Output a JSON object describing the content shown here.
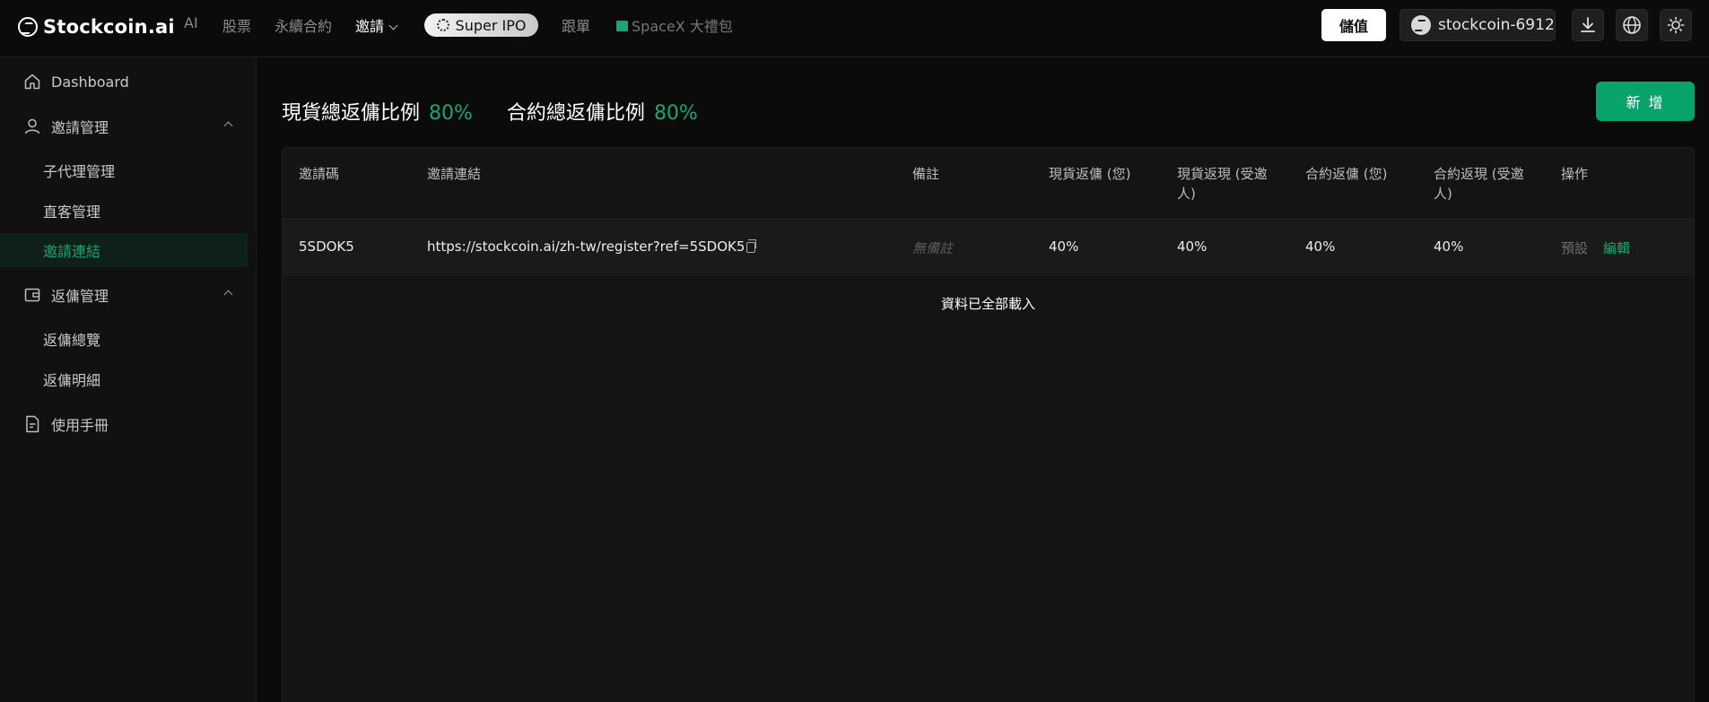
{
  "app": {
    "brand": "Stockcoin.ai"
  },
  "header": {
    "nav": {
      "ai": "AI",
      "stocks": "股票",
      "perpetual": "永續合約",
      "invite": "邀請",
      "super_ipo": "Super IPO",
      "copy_trade": "跟單",
      "spacex": "SpaceX 大禮包"
    },
    "deposit_label": "儲值",
    "username": "stockcoin-6912",
    "icons": [
      "download-icon",
      "globe-icon",
      "sun-icon"
    ]
  },
  "sidebar": {
    "dashboard": "Dashboard",
    "invite_group": {
      "label": "邀請管理",
      "items": [
        "子代理管理",
        "直客管理",
        "邀請連結"
      ],
      "active_index": 2
    },
    "rebate_group": {
      "label": "返傭管理",
      "items": [
        "返傭總覽",
        "返傭明細"
      ]
    },
    "manual": "使用手冊"
  },
  "main": {
    "spot_ratio_label": "現貨總返傭比例",
    "spot_ratio_value": "80%",
    "contract_ratio_label": "合約總返傭比例",
    "contract_ratio_value": "80%",
    "add_button": "新 增",
    "table": {
      "headers": [
        "邀請碼",
        "邀請連結",
        "備註",
        "現貨返傭 (您)",
        "現貨返現 (受邀人)",
        "合約返傭 (您)",
        "合約返現 (受邀人)",
        "操作"
      ],
      "rows": [
        {
          "code": "5SDOK5",
          "link": "https://stockcoin.ai/zh-tw/register?ref=5SDOK5",
          "note": "無備註",
          "spot_rebate": "40%",
          "spot_cashback": "40%",
          "contract_rebate": "40%",
          "contract_cashback": "40%",
          "action_default": "預設",
          "action_edit": "編輯"
        }
      ],
      "footer": "資料已全部載入"
    }
  },
  "colors": {
    "accent": "#19a672",
    "add_button": "#06a36a",
    "background": "#0b0b0b"
  }
}
